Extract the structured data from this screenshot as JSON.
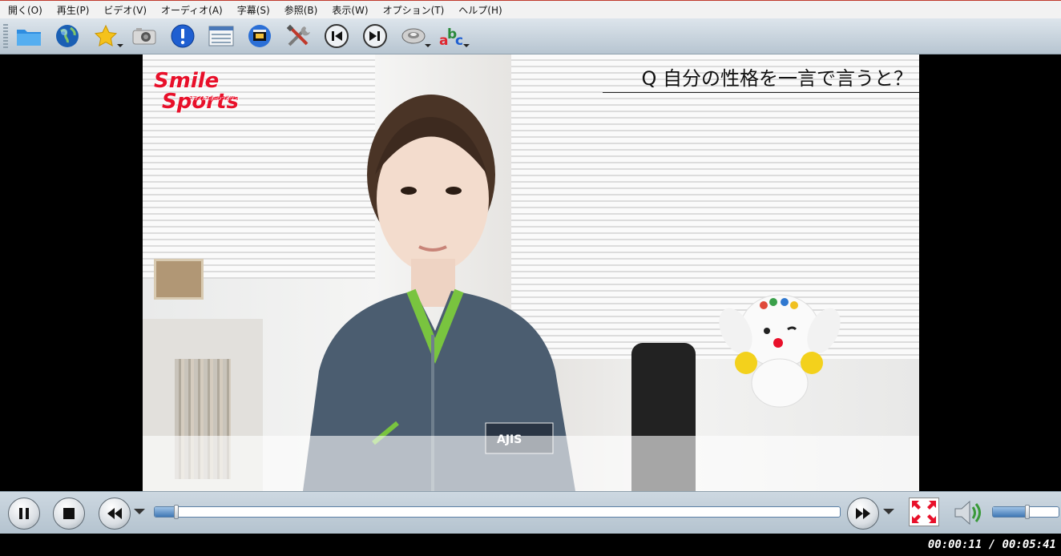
{
  "menu": [
    {
      "label": "開く(O)"
    },
    {
      "label": "再生(P)"
    },
    {
      "label": "ビデオ(V)"
    },
    {
      "label": "オーディオ(A)"
    },
    {
      "label": "字幕(S)"
    },
    {
      "label": "参照(B)"
    },
    {
      "label": "表示(W)"
    },
    {
      "label": "オプション(T)"
    },
    {
      "label": "ヘルプ(H)"
    }
  ],
  "toolbar": {
    "icons": [
      "folder-icon",
      "globe-icon",
      "star-icon",
      "camera-icon",
      "info-icon",
      "playlist-icon",
      "film-icon",
      "tools-icon",
      "previous-icon",
      "next-icon",
      "audio-icon",
      "subtitles-icon"
    ]
  },
  "video": {
    "logo_line1": "Smile",
    "logo_line2": "Sports",
    "logo_sub": "スマイルスポーツマガジン",
    "question": "Q 自分の性格を一言で言うと？"
  },
  "playback": {
    "state": "playing",
    "position_fraction": 0.032,
    "volume_fraction": 0.52
  },
  "status": {
    "time": "00:00:11 / 00:05:41"
  },
  "colors": {
    "logo": "#e8102a",
    "seek_fill": "#3f77b5",
    "menubar_bg": "#f2f2f2",
    "toolbar_bg": "#c9d4dd"
  }
}
